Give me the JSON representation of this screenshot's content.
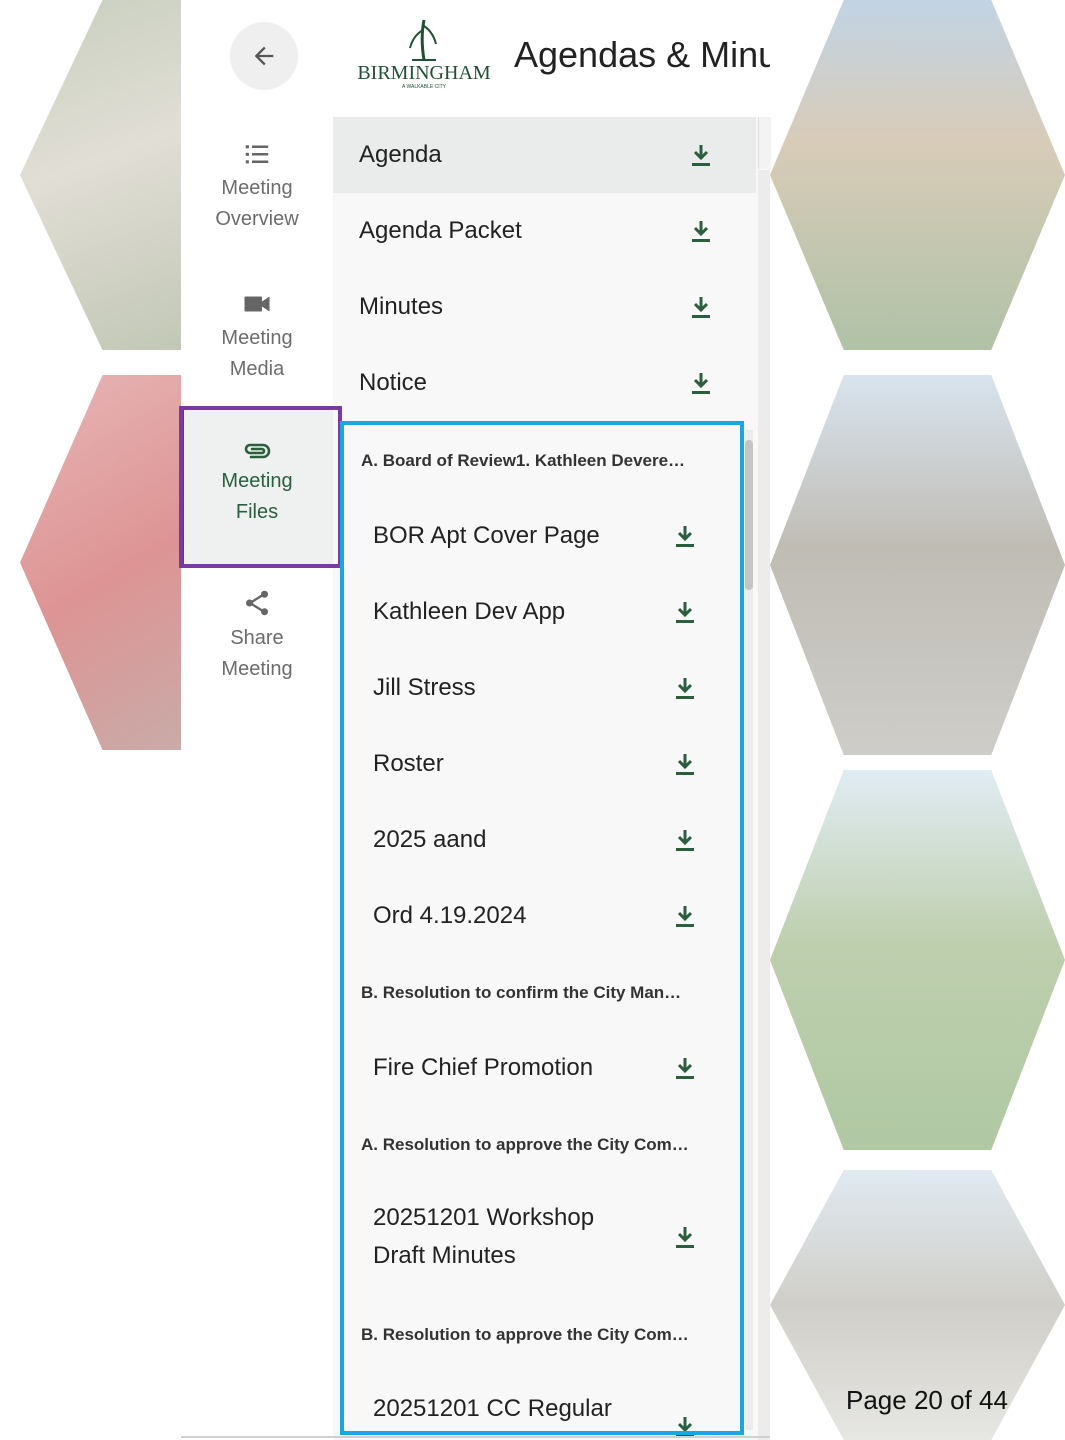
{
  "header": {
    "back_icon": "arrow-left-icon",
    "logo_text": "BIRMINGHAM",
    "logo_tagline": "A WALKABLE CITY",
    "title": "Agendas & Minu"
  },
  "rail": {
    "items": [
      {
        "icon": "list-icon",
        "line1": "Meeting",
        "line2": "Overview"
      },
      {
        "icon": "video-icon",
        "line1": "Meeting",
        "line2": "Media"
      },
      {
        "icon": "paperclip-icon",
        "line1": "Meeting",
        "line2": "Files"
      },
      {
        "icon": "share-icon",
        "line1": "Share",
        "line2": "Meeting"
      }
    ]
  },
  "documents": [
    {
      "label": "Agenda"
    },
    {
      "label": "Agenda Packet"
    },
    {
      "label": "Minutes"
    },
    {
      "label": "Notice"
    }
  ],
  "sections": [
    {
      "title": "A. Board of Review1. Kathleen Devere…",
      "files": [
        "BOR Apt Cover Page",
        "Kathleen Dev App",
        "Jill Stress",
        "Roster",
        "2025 aand",
        "Ord 4.19.2024"
      ]
    },
    {
      "title": "B. Resolution to confirm the City Man…",
      "files": [
        "Fire Chief Promotion"
      ]
    },
    {
      "title": "A. Resolution to approve the City Com…",
      "files": [
        "20251201 Workshop Draft Minutes"
      ]
    },
    {
      "title": "B. Resolution to approve the City Com…",
      "files": [
        "20251201 CC Regular"
      ]
    }
  ],
  "footer": {
    "page": "Page 20 of 44"
  },
  "colors": {
    "accent_green": "#2b5e3d",
    "highlight_purple": "#7a3aa3",
    "highlight_blue": "#1aa7e0"
  }
}
